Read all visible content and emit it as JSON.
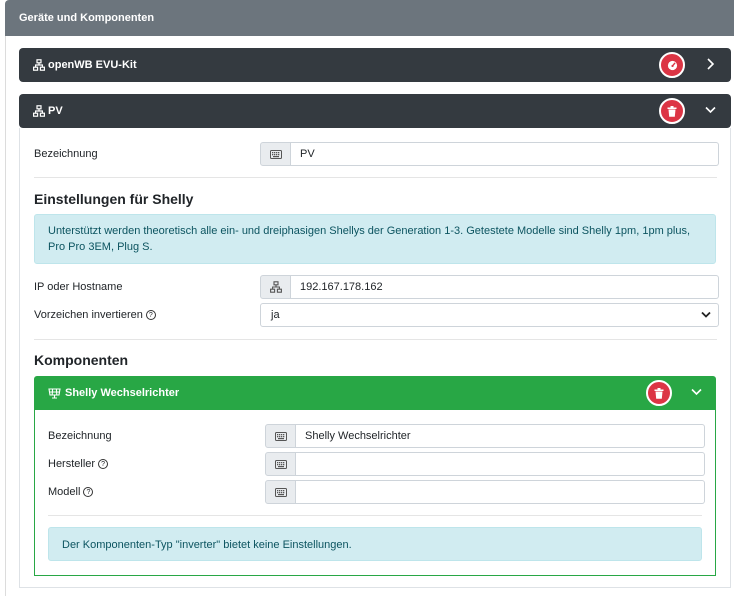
{
  "section_title": "Geräte und Komponenten",
  "devices": [
    {
      "name": "openWB EVU-Kit",
      "expanded": false
    },
    {
      "name": "PV",
      "expanded": true
    }
  ],
  "pv": {
    "bezeichnung_label": "Bezeichnung",
    "bezeichnung_value": "PV",
    "settings_heading": "Einstellungen für Shelly",
    "info_text": "Unterstützt werden theoretisch alle ein- und dreiphasigen Shellys der Generation 1-3. Getestete Modelle sind Shelly 1pm, 1pm plus, Pro Pro 3EM, Plug S.",
    "ip_label": "IP oder Hostname",
    "ip_value": "192.167.178.162",
    "invert_label": "Vorzeichen invertieren",
    "invert_value": "ja"
  },
  "components": {
    "heading": "Komponenten",
    "component": {
      "name": "Shelly Wechselrichter",
      "bezeichnung_label": "Bezeichnung",
      "bezeichnung_value": "Shelly Wechselrichter",
      "hersteller_label": "Hersteller",
      "hersteller_value": "",
      "modell_label": "Modell",
      "modell_value": "",
      "info_text": "Der Komponenten-Typ \"inverter\" bietet keine Einstellungen."
    }
  },
  "colors": {
    "header_gray": "#6c757d",
    "dark_bar": "#343a40",
    "danger": "#dc3545",
    "success": "#28a745",
    "info_bg": "#d1ecf1",
    "info_text": "#0c5460"
  },
  "icons": {
    "network": "network-icon",
    "keyboard": "keyboard-icon",
    "trash": "trash-icon",
    "gauge": "gauge-icon",
    "solar_panel": "solar-panel-icon",
    "chevron_right": "chevron-right-icon",
    "chevron_down": "chevron-down-icon",
    "question": "question-circle-icon"
  }
}
